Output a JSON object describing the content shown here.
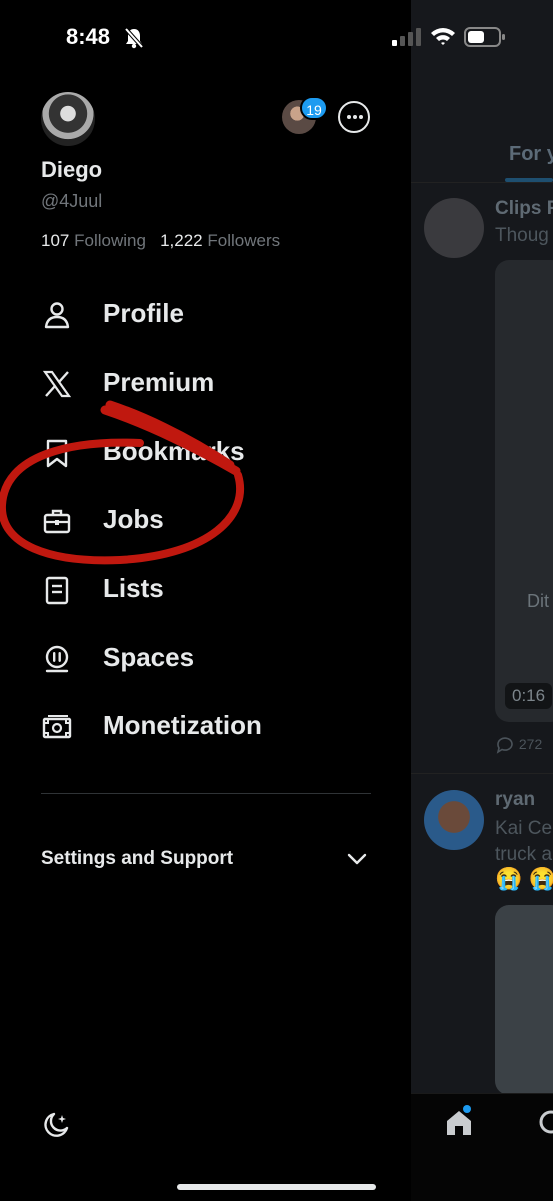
{
  "status_bar": {
    "time": "8:48"
  },
  "profile": {
    "name": "Diego",
    "handle": "@4Juul",
    "following_count": "107",
    "following_label": "Following",
    "followers_count": "1,222",
    "followers_label": "Followers",
    "notification_badge": "19"
  },
  "menu": [
    {
      "label": "Profile",
      "icon": "person-icon"
    },
    {
      "label": "Premium",
      "icon": "x-logo-icon"
    },
    {
      "label": "Bookmarks",
      "icon": "bookmark-icon"
    },
    {
      "label": "Jobs",
      "icon": "briefcase-icon"
    },
    {
      "label": "Lists",
      "icon": "list-icon"
    },
    {
      "label": "Spaces",
      "icon": "microphone-icon"
    },
    {
      "label": "Monetization",
      "icon": "money-icon"
    }
  ],
  "settings": {
    "label": "Settings and Support"
  },
  "timeline": {
    "tab_label": "For y",
    "post1": {
      "name": "Clips F",
      "text": "Thoug",
      "media_caption": "Dit",
      "duration": "0:16",
      "replies": "272"
    },
    "post2": {
      "name": "ryan",
      "text_line1": "Kai Ce",
      "text_line2": "truck a",
      "emoji": "😭 😭"
    }
  },
  "colors": {
    "accent": "#1d9bf0",
    "annotation": "#c0180f",
    "background": "#000000"
  }
}
